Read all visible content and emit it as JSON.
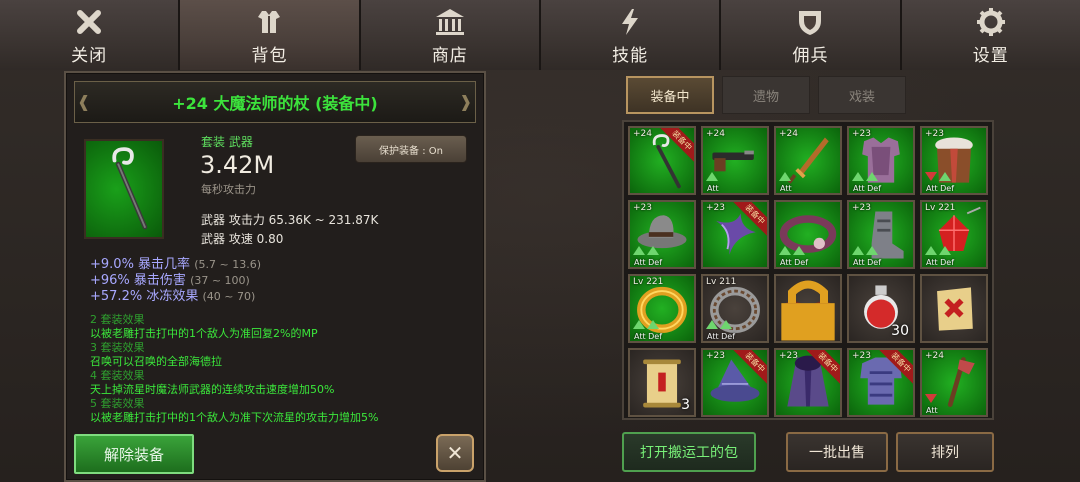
{
  "nav": {
    "tabs": [
      {
        "label": "关闭",
        "icon": "close-icon"
      },
      {
        "label": "背包",
        "icon": "armor-icon"
      },
      {
        "label": "商店",
        "icon": "shop-icon"
      },
      {
        "label": "技能",
        "icon": "lightning-icon"
      },
      {
        "label": "佣兵",
        "icon": "shield-icon"
      },
      {
        "label": "设置",
        "icon": "gear-icon"
      }
    ],
    "active_index": 1
  },
  "detail": {
    "title": "+24 大魔法师的杖 (装备中)",
    "set_type": "套装 武器",
    "dps_value": "3.42M",
    "dps_label": "每秒攻击力",
    "protect_label": "保护装备 : On",
    "weapon_attack": "武器 攻击力 65.36K ~ 231.87K",
    "weapon_speed": "武器 攻速 0.80",
    "bonuses": [
      {
        "text": "+9.0% 暴击几率",
        "range": "(5.7 ~ 13.6)"
      },
      {
        "text": "+96% 暴击伤害",
        "range": "(37 ~ 100)"
      },
      {
        "text": "+57.2% 冰冻效果",
        "range": "(40 ~ 70)"
      }
    ],
    "set_effects": [
      {
        "head": "2 套装效果",
        "body": "以被老雕打击打中的1个敌人为准回复2%的MP"
      },
      {
        "head": "3 套装效果",
        "body": "召唤可以召唤的全部海德拉"
      },
      {
        "head": "4 套装效果",
        "body": "天上掉流星时魔法师武器的连续攻击速度增加50%"
      },
      {
        "head": "5 套装效果",
        "body": "以被老雕打击打中的1个敌人为准下次流星的攻击力增加5%"
      }
    ],
    "unequip_label": "解除装备",
    "close_label": "✕"
  },
  "inventory": {
    "tabs": [
      "装备中",
      "遗物",
      "戏装"
    ],
    "active_tab": 0,
    "items": [
      {
        "level": "+24",
        "ribbon": "装备中",
        "bg": "green",
        "kind": "staff",
        "arrows": []
      },
      {
        "level": "+24",
        "ribbon": "",
        "bg": "green",
        "kind": "gun",
        "arrows": [
          "up"
        ],
        "tags": "Att"
      },
      {
        "level": "+24",
        "ribbon": "",
        "bg": "green",
        "kind": "dagger",
        "arrows": [
          "up"
        ],
        "tags": "Att"
      },
      {
        "level": "+23",
        "ribbon": "",
        "bg": "green",
        "kind": "armor",
        "arrows": [
          "up",
          "up"
        ],
        "tags": "Att Def"
      },
      {
        "level": "+23",
        "ribbon": "",
        "bg": "green",
        "kind": "fur-armor",
        "arrows": [
          "down",
          "up"
        ],
        "tags": "Att Def"
      },
      {
        "level": "+23",
        "ribbon": "",
        "bg": "green",
        "kind": "hat",
        "arrows": [
          "up",
          "up"
        ],
        "tags": "Att Def"
      },
      {
        "level": "+23",
        "ribbon": "装备中",
        "bg": "green",
        "kind": "claw",
        "arrows": [],
        "tags": ""
      },
      {
        "level": "",
        "ribbon": "",
        "bg": "green",
        "kind": "belt",
        "arrows": [
          "up",
          "up"
        ],
        "tags": "Att Def"
      },
      {
        "level": "+23",
        "ribbon": "",
        "bg": "green",
        "kind": "boots",
        "arrows": [
          "up",
          "up"
        ],
        "tags": "Att Def"
      },
      {
        "level": "Lv 221",
        "ribbon": "",
        "bg": "green",
        "kind": "gem",
        "arrows": [
          "up",
          "up"
        ],
        "tags": "Att Def"
      },
      {
        "level": "Lv 221",
        "ribbon": "",
        "bg": "green",
        "kind": "ring-gold",
        "arrows": [
          "up",
          "up"
        ],
        "tags": "Att Def"
      },
      {
        "level": "Lv 211",
        "ribbon": "",
        "bg": "dark",
        "kind": "ring-silver",
        "arrows": [
          "up",
          "up"
        ],
        "tags": "Att Def"
      },
      {
        "level": "",
        "ribbon": "",
        "bg": "dark",
        "kind": "wings",
        "arrows": [],
        "tags": "",
        "locked": true
      },
      {
        "level": "",
        "ribbon": "",
        "bg": "dark",
        "kind": "potion",
        "arrows": [],
        "tags": "",
        "count": "30"
      },
      {
        "level": "",
        "ribbon": "",
        "bg": "dark",
        "kind": "scroll-red",
        "arrows": [],
        "tags": ""
      },
      {
        "level": "",
        "ribbon": "",
        "bg": "dark",
        "kind": "scroll",
        "arrows": [],
        "tags": "",
        "count": "3"
      },
      {
        "level": "+23",
        "ribbon": "装备中",
        "bg": "green",
        "kind": "wizard-hat",
        "arrows": [],
        "tags": ""
      },
      {
        "level": "+23",
        "ribbon": "装备中",
        "bg": "green",
        "kind": "robe",
        "arrows": [],
        "tags": ""
      },
      {
        "level": "+23",
        "ribbon": "装备中",
        "bg": "green",
        "kind": "plate",
        "arrows": [],
        "tags": ""
      },
      {
        "level": "+24",
        "ribbon": "",
        "bg": "green",
        "kind": "axe",
        "arrows": [
          "down"
        ],
        "tags": "Att"
      }
    ]
  },
  "buttons": {
    "open_porter_bag": "打开搬运工的包",
    "bulk_sell": "一批出售",
    "sort": "排列"
  },
  "colors": {
    "title_green": "#3ce33c",
    "set_green": "#3be83b",
    "bonus_purple": "#a8a8ff",
    "ribbon_red": "#a11a1a"
  }
}
